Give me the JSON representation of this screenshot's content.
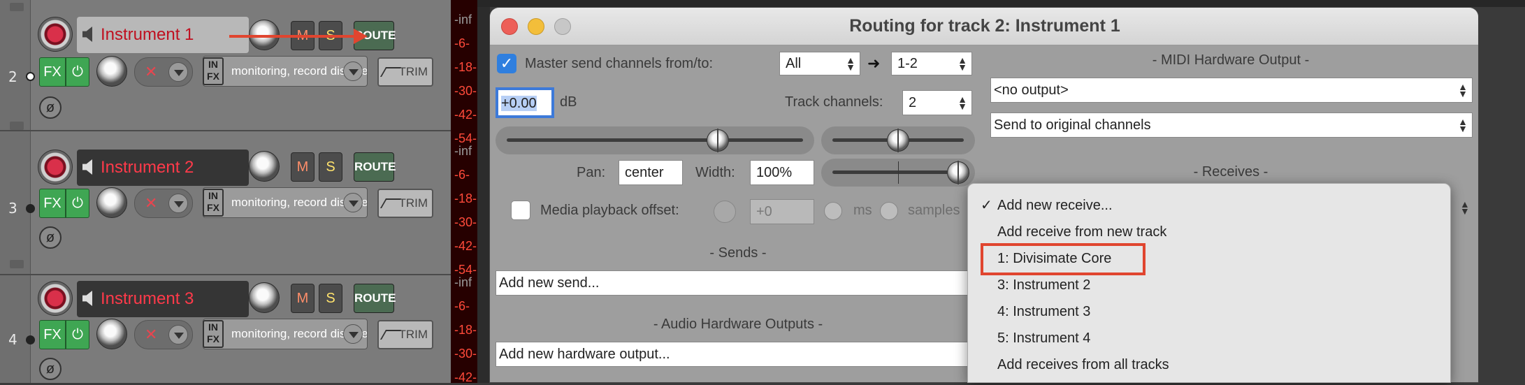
{
  "tracks": [
    {
      "number": "2",
      "name": "Instrument 1",
      "monitor": "monitoring, record disabled",
      "selected": true
    },
    {
      "number": "3",
      "name": "Instrument 2",
      "monitor": "monitoring, record disabled",
      "selected": false
    },
    {
      "number": "4",
      "name": "Instrument 3",
      "monitor": "monitoring, record disabled",
      "selected": false
    }
  ],
  "track_buttons": {
    "mute": "M",
    "solo": "S",
    "route": "ROUTE",
    "fx": "FX",
    "power": "⏻",
    "trim": "TRIM",
    "infx_top": "IN",
    "infx_bottom": "FX",
    "phase": "ø",
    "mute_x": "✕"
  },
  "meter_labels": [
    "-inf",
    "-6-",
    "-18-",
    "-30-",
    "-42-",
    "-54-"
  ],
  "dialog": {
    "title": "Routing for track 2: Instrument 1",
    "master_send_label": "Master send channels from/to:",
    "master_send_checked": true,
    "from_channels": "All",
    "arrow": "➜",
    "to_channels": "1-2",
    "volume": "+0.00",
    "volume_unit": "dB",
    "track_channels_label": "Track channels:",
    "track_channels": "2",
    "pan_label": "Pan:",
    "pan": "center",
    "width_label": "Width:",
    "width": "100%",
    "volume_level": 0.72,
    "pan_level": 0.5,
    "width_level": 1.0,
    "media_offset_label": "Media playback offset:",
    "media_offset_value": "+0",
    "ms_label": "ms",
    "samples_label": "samples",
    "sends_header": "-  Sends  -",
    "add_send": "Add new send...",
    "hw_header": "-  Audio Hardware Outputs  -",
    "add_hw": "Add new hardware output...",
    "midi_header": "-  MIDI Hardware Output  -",
    "midi_output": "<no output>",
    "midi_channels": "Send to original channels",
    "receives_header": "-  Receives  -"
  },
  "menu": {
    "check": "✓",
    "items": [
      "Add new receive...",
      "Add receive from new track",
      "1: Divisimate Core",
      "3: Instrument 2",
      "4: Instrument 3",
      "5: Instrument 4",
      "Add receives from all tracks"
    ],
    "highlighted_index": 2
  },
  "colors": {
    "accent_red": "#e0452f",
    "fx_green": "#3fa653",
    "track_name_red": "#ff3a4a",
    "meter_bg": "#260000"
  }
}
